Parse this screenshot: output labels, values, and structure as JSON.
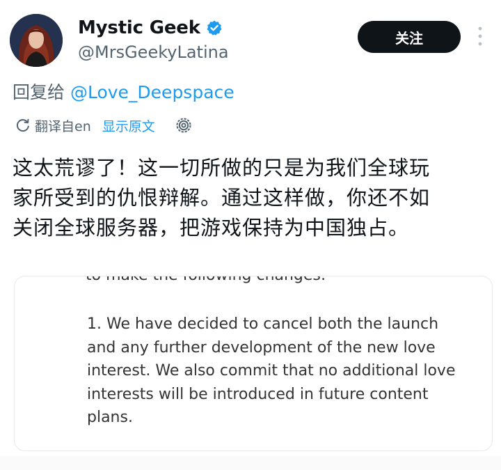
{
  "author": {
    "display_name": "Mystic Geek",
    "handle": "@MrsGeekyLatina",
    "verified_icon": "verified-badge-icon",
    "verified_color": "#1d9bf0"
  },
  "actions": {
    "follow_label": "关注",
    "more_icon": "more-vertical-icon"
  },
  "reply": {
    "prefix": "回复给",
    "mention": "@Love_Deepspace"
  },
  "translation": {
    "icon": "translate-icon",
    "translated_from": "翻译自en",
    "show_original": "显示原文",
    "settings_icon": "gear-icon"
  },
  "tweet": {
    "lines": [
      "这太荒谬了！这一切所做的只是为我们全球玩",
      "家所受到的仇恨辩解。通过这样做，你还不如",
      "关闭全球服务器，把游戏保持为中国独占。"
    ]
  },
  "attached_image": {
    "cut_line": "to make the following changes:",
    "lines": [
      "1. We have decided to cancel both the launch",
      "and any further development of the new love",
      "interest. We also commit that no additional love",
      "interests will be introduced in future content",
      "plans."
    ]
  },
  "colors": {
    "text_primary": "#0f1419",
    "text_secondary": "#536471",
    "link": "#1d9bf0",
    "button_bg": "#0f1419"
  }
}
